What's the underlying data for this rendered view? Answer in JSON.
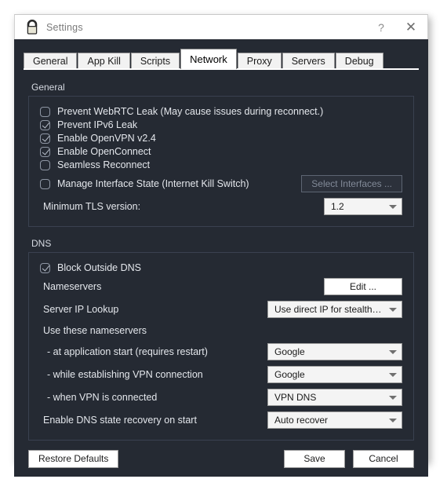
{
  "window": {
    "title": "Settings",
    "icon": "lock-icon",
    "help_label": "?",
    "close_label": "✕",
    "bg_color": "#252a33"
  },
  "tabs": [
    {
      "label": "General",
      "active": false
    },
    {
      "label": "App Kill",
      "active": false
    },
    {
      "label": "Scripts",
      "active": false
    },
    {
      "label": "Network",
      "active": true
    },
    {
      "label": "Proxy",
      "active": false
    },
    {
      "label": "Servers",
      "active": false
    },
    {
      "label": "Debug",
      "active": false
    }
  ],
  "general_group": {
    "title": "General",
    "checkboxes": [
      {
        "label": "Prevent WebRTC Leak (May cause issues during reconnect.)",
        "checked": false
      },
      {
        "label": "Prevent IPv6 Leak",
        "checked": true
      },
      {
        "label": "Enable OpenVPN v2.4",
        "checked": true
      },
      {
        "label": "Enable OpenConnect",
        "checked": true
      },
      {
        "label": "Seamless Reconnect",
        "checked": false
      }
    ],
    "kill_switch": {
      "label": "Manage Interface State (Internet Kill Switch)",
      "checked": false,
      "button_label": "Select Interfaces ...",
      "button_disabled": true
    },
    "tls": {
      "label": "Minimum TLS version:",
      "value": "1.2"
    }
  },
  "dns_group": {
    "title": "DNS",
    "block_outside_dns": {
      "label": "Block Outside DNS",
      "checked": true
    },
    "nameservers": {
      "label": "Nameservers",
      "button_label": "Edit ..."
    },
    "server_ip_lookup": {
      "label": "Server IP Lookup",
      "value": "Use direct IP for stealth only"
    },
    "use_these_label": "Use these nameservers",
    "rows": [
      {
        "label": "- at application start (requires restart)",
        "value": "Google"
      },
      {
        "label": "- while establishing VPN connection",
        "value": "Google"
      },
      {
        "label": "- when VPN is connected",
        "value": "VPN DNS"
      },
      {
        "label": "Enable DNS state recovery on start",
        "value": "Auto recover"
      }
    ]
  },
  "footer": {
    "restore_label": "Restore Defaults",
    "save_label": "Save",
    "cancel_label": "Cancel"
  }
}
